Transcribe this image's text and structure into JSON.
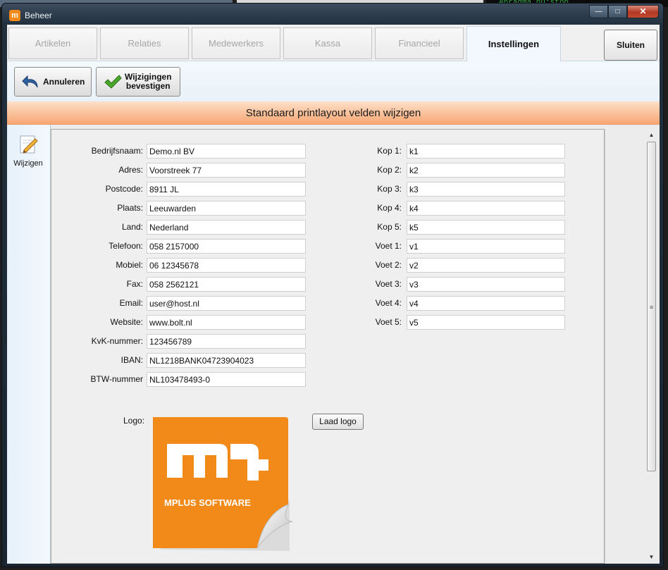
{
  "window": {
    "title": "Beheer",
    "app_icon": "mplus-icon"
  },
  "tabs": [
    {
      "label": "Artikelen",
      "active": false
    },
    {
      "label": "Relaties",
      "active": false
    },
    {
      "label": "Medewerkers",
      "active": false
    },
    {
      "label": "Kassa",
      "active": false
    },
    {
      "label": "Financieel",
      "active": false
    },
    {
      "label": "Instellingen",
      "active": true
    }
  ],
  "close_button": "Sluiten",
  "toolbar": {
    "cancel_label": "Annuleren",
    "confirm_line1": "Wijzigingen",
    "confirm_line2": "bevestigen"
  },
  "banner": "Standaard printlayout velden wijzigen",
  "sidebar": {
    "edit_label": "Wijzigen"
  },
  "company_fields": [
    {
      "label": "Bedrijfsnaam:",
      "value": "Demo.nl BV"
    },
    {
      "label": "Adres:",
      "value": "Voorstreek 77"
    },
    {
      "label": "Postcode:",
      "value": "8911 JL"
    },
    {
      "label": "Plaats:",
      "value": "Leeuwarden"
    },
    {
      "label": "Land:",
      "value": "Nederland"
    },
    {
      "label": "Telefoon:",
      "value": "058 2157000"
    },
    {
      "label": "Mobiel:",
      "value": "06 12345678"
    },
    {
      "label": "Fax:",
      "value": "058 2562121"
    },
    {
      "label": "Email:",
      "value": "user@host.nl"
    },
    {
      "label": "Website:",
      "value": "www.bolt.nl"
    },
    {
      "label": "KvK-nummer:",
      "value": "123456789"
    },
    {
      "label": "IBAN:",
      "value": "NL1218BANK04723904023"
    },
    {
      "label": "BTW-nummer",
      "value": "NL103478493-0"
    }
  ],
  "header_footer_fields": [
    {
      "label": "Kop 1:",
      "value": "k1"
    },
    {
      "label": "Kop 2:",
      "value": "k2"
    },
    {
      "label": "Kop 3:",
      "value": "k3"
    },
    {
      "label": "Kop 4:",
      "value": "k4"
    },
    {
      "label": "Kop 5:",
      "value": "k5"
    },
    {
      "label": "Voet 1:",
      "value": "v1"
    },
    {
      "label": "Voet 2:",
      "value": "v2"
    },
    {
      "label": "Voet 3:",
      "value": "v3"
    },
    {
      "label": "Voet 4:",
      "value": "v4"
    },
    {
      "label": "Voet 5:",
      "value": "v5"
    }
  ],
  "logo": {
    "label": "Logo:",
    "load_button": "Laad logo",
    "brand_text": "MPLUS SOFTWARE",
    "brand_color": "#f28a1a"
  },
  "background": {
    "code_snippet": "#pragma nu:stop"
  }
}
